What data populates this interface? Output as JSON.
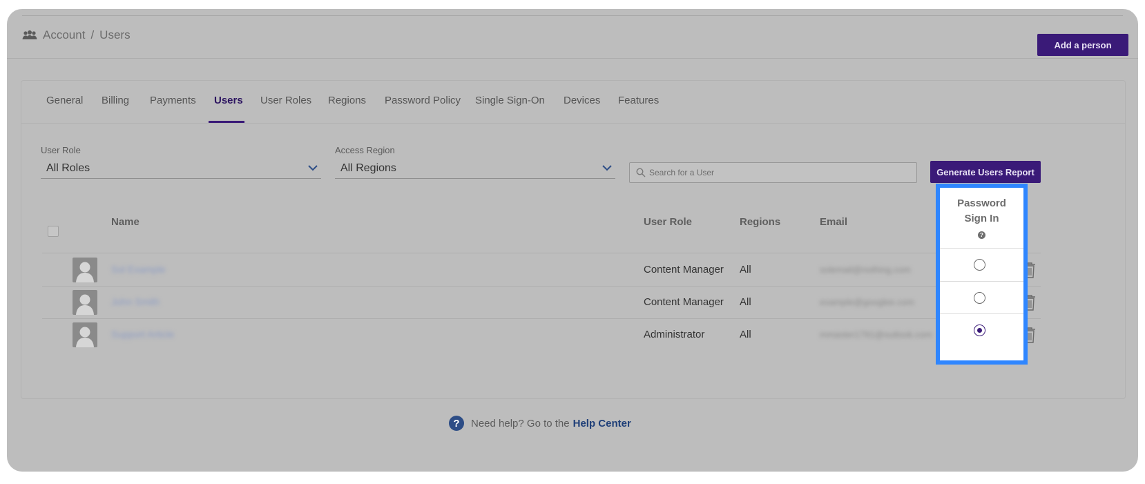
{
  "header": {
    "breadcrumb": [
      "Account",
      "Users"
    ],
    "breadcrumb_sep": "/",
    "add_button": "Add a person"
  },
  "tabs": [
    {
      "label": "General"
    },
    {
      "label": "Billing"
    },
    {
      "label": "Payments"
    },
    {
      "label": "Users",
      "active": true
    },
    {
      "label": "User Roles"
    },
    {
      "label": "Regions"
    },
    {
      "label": "Password Policy"
    },
    {
      "label": "Single Sign-On"
    },
    {
      "label": "Devices"
    },
    {
      "label": "Features"
    }
  ],
  "filters": {
    "role_label": "User Role",
    "role_value": "All Roles",
    "region_label": "Access Region",
    "region_value": "All Regions",
    "search_placeholder": "Search for a User",
    "report_button": "Generate Users Report"
  },
  "table": {
    "headers": {
      "name": "Name",
      "role": "User Role",
      "regions": "Regions",
      "email": "Email",
      "password_line1": "Password",
      "password_line2": "Sign In",
      "password_help": "?"
    },
    "rows": [
      {
        "name": "Sol Example",
        "role": "Content Manager",
        "regions": "All",
        "email": "solemail@nothing.com",
        "password_sign_in": false
      },
      {
        "name": "John Smith",
        "role": "Content Manager",
        "regions": "All",
        "email": "example@googlee.com",
        "password_sign_in": false
      },
      {
        "name": "Support Article",
        "role": "Administrator",
        "regions": "All",
        "email": "mmaster1791@outlook.com",
        "password_sign_in": true
      }
    ]
  },
  "help": {
    "icon": "?",
    "text": "Need help? Go to the",
    "link": "Help Center"
  },
  "colors": {
    "brand": "#3a1a78",
    "highlight": "#2f86ff"
  }
}
